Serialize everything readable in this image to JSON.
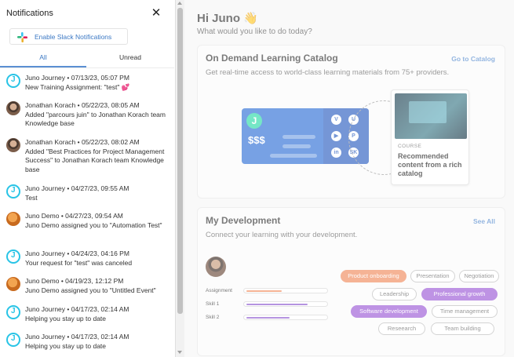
{
  "main": {
    "greeting": "Hi Juno",
    "greeting_emoji": "👋",
    "subtitle": "What would you like to do today?",
    "catalog": {
      "title": "On Demand Learning Catalog",
      "description": "Get real-time access to world-class learning materials from 75+ providers.",
      "link": "Go to Catalog",
      "illustration_price": "$$$",
      "illustration_chips": [
        "V",
        "U",
        "▶",
        "P",
        "in",
        "SK"
      ],
      "course_tag": "COURSE",
      "course_text": "Recommended content from a rich catalog"
    },
    "development": {
      "title": "My Development",
      "description": "Connect your learning with your development.",
      "link": "See All",
      "skills": [
        {
          "label": "Assignment",
          "level": 0.45,
          "color": "#f08a5d"
        },
        {
          "label": "Skill 1",
          "level": 0.78,
          "color": "#8e5bd0"
        },
        {
          "label": "Skill 2",
          "level": 0.55,
          "color": "#8e5bd0"
        }
      ],
      "tags": [
        "Product onboarding",
        "Presentation",
        "Negotiation",
        "Leadership",
        "Professional growth",
        "Software development",
        "Time management",
        "Reseearch",
        "Team building"
      ]
    }
  },
  "notifications": {
    "title": "Notifications",
    "slack_button": "Enable Slack Notifications",
    "tabs": {
      "all": "All",
      "unread": "Unread"
    },
    "items": [
      {
        "avatar": "juno",
        "header": "Juno Journey • 07/13/23, 05:07 PM",
        "body": "New Training Assignment: \"test\" 💕"
      },
      {
        "avatar": "person",
        "header": "Jonathan Korach • 05/22/23, 08:05 AM",
        "body": "Added \"parcours juin\" to Jonathan Korach team Knowledge base"
      },
      {
        "avatar": "person",
        "header": "Jonathan Korach • 05/22/23, 08:02 AM",
        "body": "Added \"Best Practices for Project Management Success\" to Jonathan Korach team Knowledge base"
      },
      {
        "avatar": "juno",
        "header": "Juno Journey • 04/27/23, 09:55 AM",
        "body": "Test"
      },
      {
        "avatar": "demo",
        "header": "Juno Demo • 04/27/23, 09:54 AM",
        "body": "Juno Demo assigned you to \"Automation Test\""
      },
      {
        "avatar": "juno",
        "header": "Juno Journey • 04/24/23, 04:16 PM",
        "body": "Your request for \"test\" was canceled"
      },
      {
        "avatar": "demo",
        "header": "Juno Demo • 04/19/23, 12:12 PM",
        "body": "Juno Demo assigned you to \"Untitled Event\""
      },
      {
        "avatar": "juno",
        "header": "Juno Journey • 04/17/23, 02:14 AM",
        "body": "Helping you stay up to date"
      },
      {
        "avatar": "juno",
        "header": "Juno Journey • 04/17/23, 02:14 AM",
        "body": "Helping you stay up to date"
      }
    ]
  }
}
